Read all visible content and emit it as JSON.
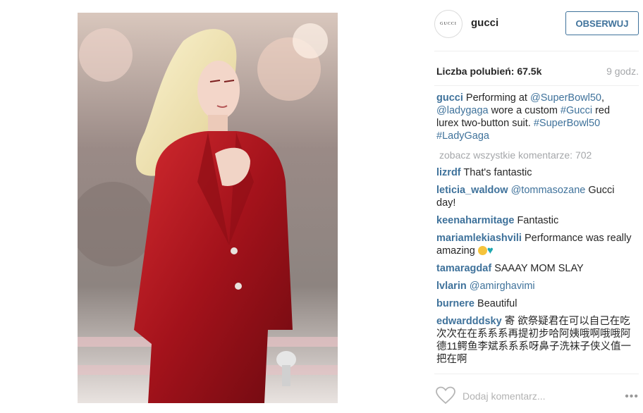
{
  "post": {
    "username": "gucci",
    "avatar_text": "GUCCI",
    "follow_label": "OBSERWUJ",
    "likes_label": "Liczba polubień:",
    "likes_count": "67.5k",
    "time": "9 godz.",
    "caption": {
      "user": "gucci",
      "parts": [
        "Performing at ",
        "@SuperBowl50",
        ", ",
        "@ladygaga",
        " wore a custom ",
        "#Gucci",
        " red lurex two-button suit. ",
        "#SuperBowl50",
        " ",
        "#LadyGaga"
      ]
    },
    "view_all_label": "zobacz wszystkie komentarze: 702",
    "comments": [
      {
        "user": "lizrdf",
        "text": "That's fantastic"
      },
      {
        "user": "leticia_waldow",
        "mention": "@tommasozane",
        "text": " Gucci day!"
      },
      {
        "user": "keenaharmitage",
        "text": "Fantastic"
      },
      {
        "user": "mariamlekiashvili",
        "text": "Performance was really amazing "
      },
      {
        "user": "tamaragdaf",
        "text": "SAAAY MOM SLAY"
      },
      {
        "user": "lvlarin",
        "mention": "@amirghavimi"
      },
      {
        "user": "burnere",
        "text": "Beautiful"
      },
      {
        "user": "edwardddsky",
        "text": "寄 欲祭疑君在可以自己在吃次次在在系系系再提初步哈阿姨哦啊哦哦阿德11鳄鱼李斌系系系呀鼻子洗袜子侠义值一把在啊"
      }
    ],
    "comment_placeholder": "Dodaj komentarz...",
    "more_label": "•••"
  },
  "icons": {
    "like": "heart-outline-icon",
    "more": "more-options-icon",
    "emoji1": "smiling-face-emoji",
    "emoji2": "blue-heart-emoji"
  },
  "colors": {
    "link": "#3f729b",
    "muted": "#a5a7aa",
    "suit": "#b0141c"
  }
}
